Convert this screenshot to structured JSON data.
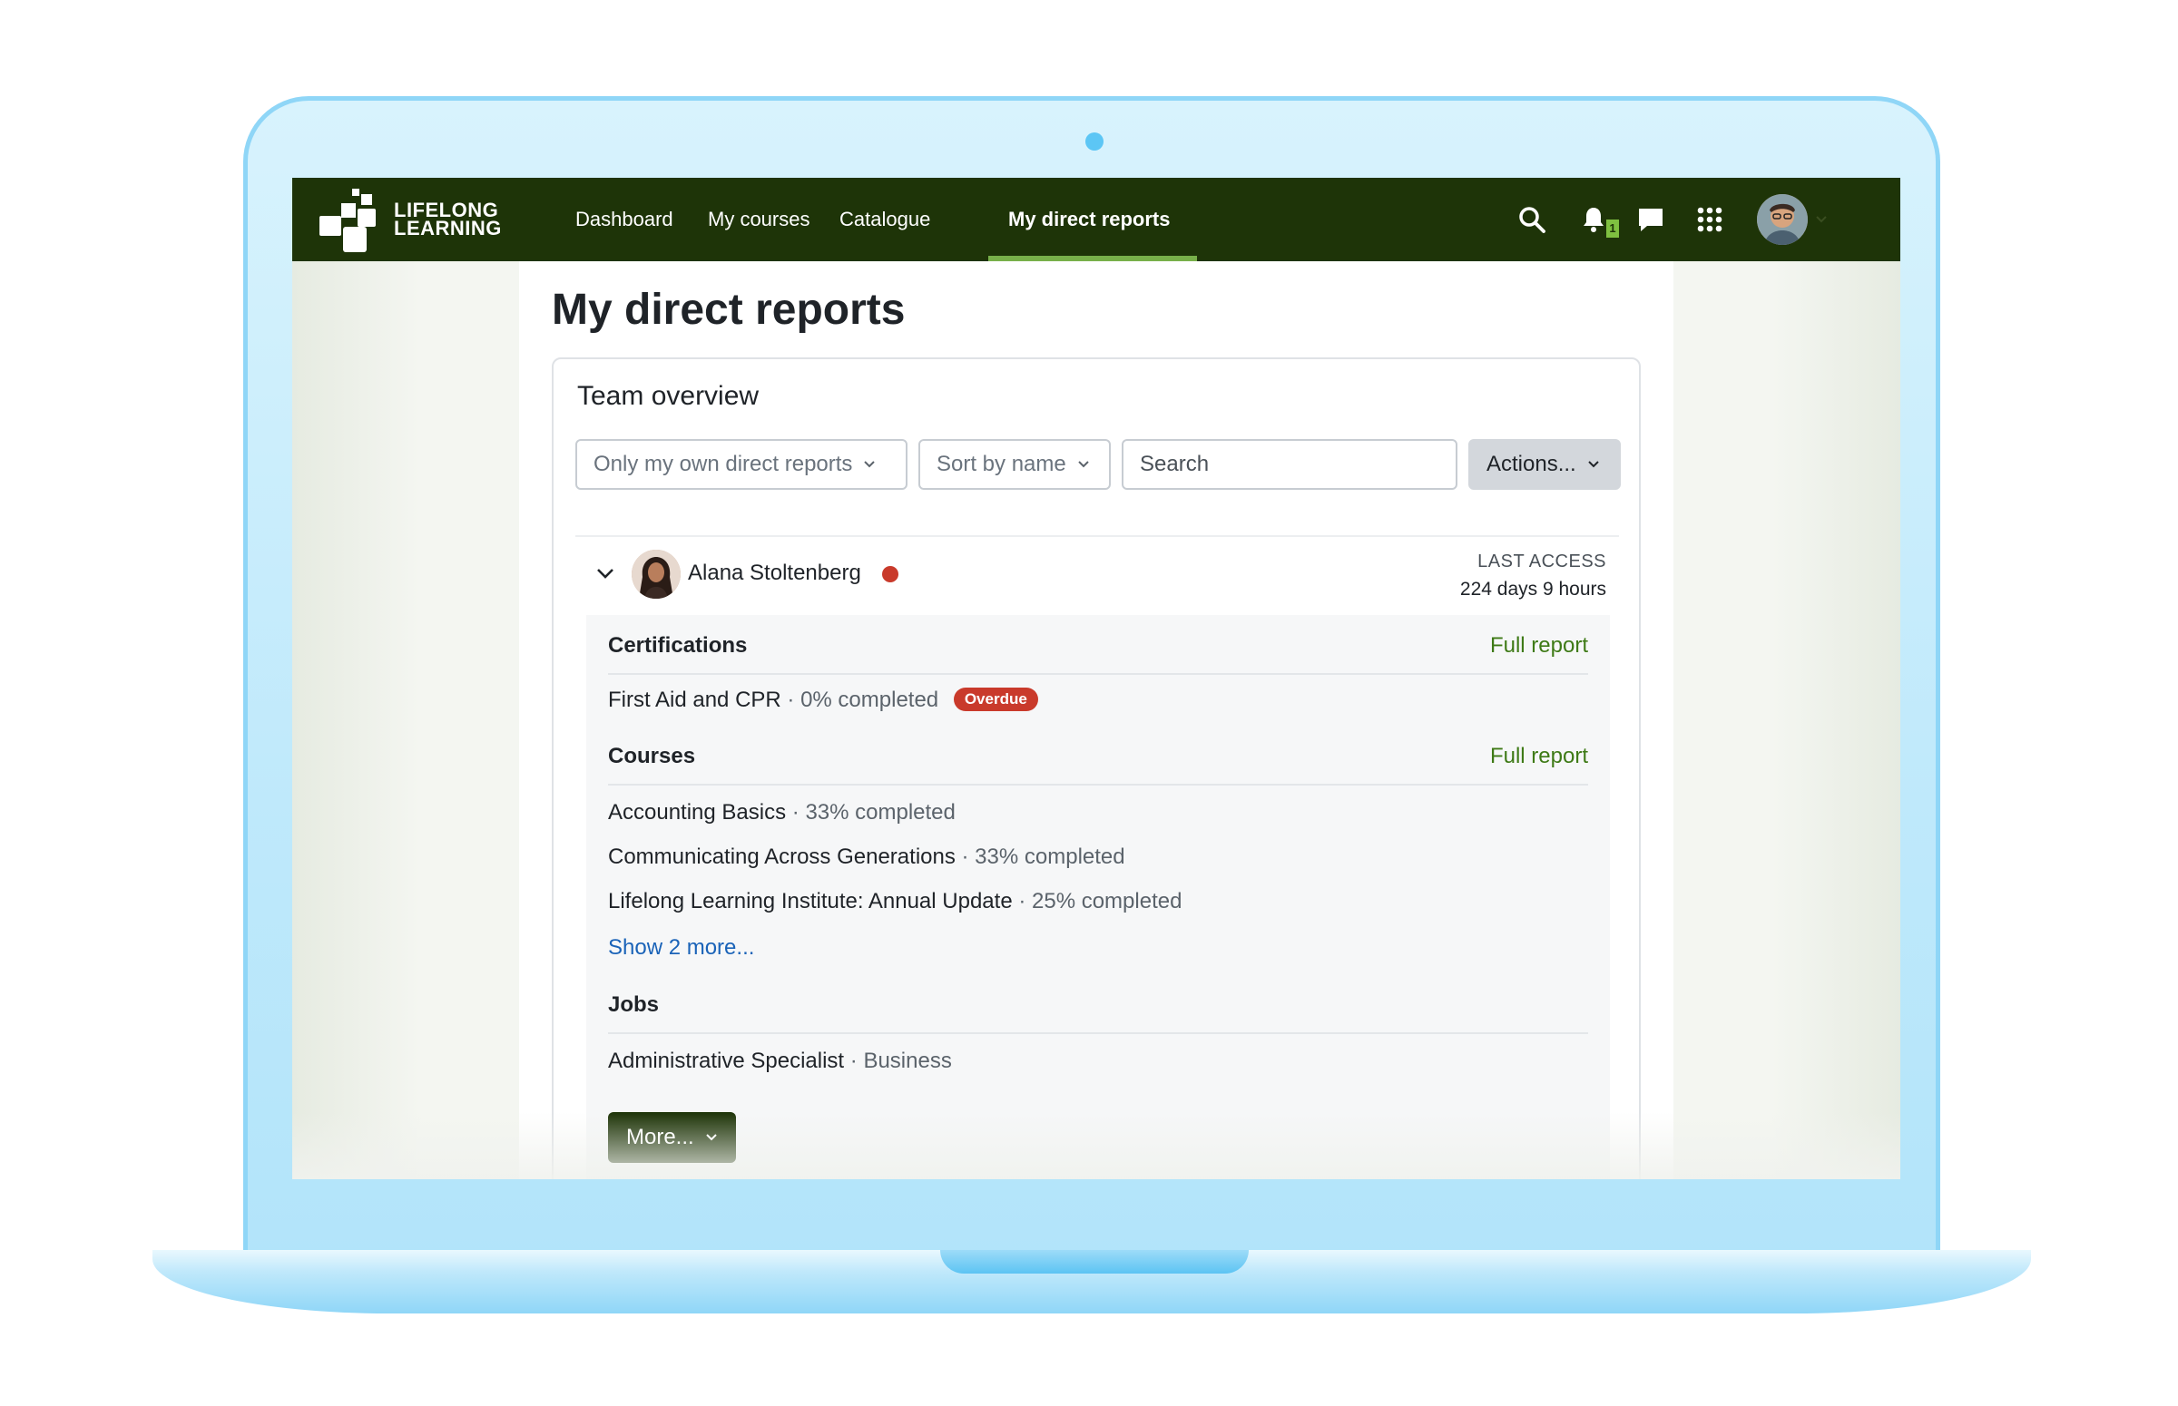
{
  "nav": {
    "brand_line1": "LIFELONG",
    "brand_line2": "LEARNING",
    "items": [
      {
        "label": "Dashboard"
      },
      {
        "label": "My courses"
      },
      {
        "label": "Catalogue"
      },
      {
        "label": "My direct reports",
        "active": true
      }
    ],
    "notification_count": "1",
    "icons": [
      "search-icon",
      "bell-icon",
      "chat-icon",
      "apps-grid-icon",
      "user-avatar"
    ]
  },
  "page": {
    "title": "My direct reports"
  },
  "card": {
    "title": "Team overview",
    "filter_label": "Only my own direct reports",
    "sort_label": "Sort by name",
    "search_placeholder": "Search",
    "actions_label": "Actions..."
  },
  "person": {
    "name": "Alana Stoltenberg",
    "status_color": "#c93a2b",
    "last_access_label": "LAST ACCESS",
    "last_access_value": "224 days 9 hours",
    "certifications": {
      "title": "Certifications",
      "full_report": "Full report",
      "items": [
        {
          "name": "First Aid and CPR",
          "progress": "· 0% completed",
          "badge": "Overdue"
        }
      ]
    },
    "courses": {
      "title": "Courses",
      "full_report": "Full report",
      "items": [
        {
          "name": "Accounting Basics",
          "progress": "· 33% completed"
        },
        {
          "name": "Communicating Across Generations",
          "progress": "· 33% completed"
        },
        {
          "name": "Lifelong Learning Institute: Annual Update",
          "progress": "· 25% completed"
        }
      ],
      "show_more": "Show 2 more..."
    },
    "jobs": {
      "title": "Jobs",
      "items": [
        {
          "name": "Administrative Specialist",
          "org": "· Business"
        }
      ]
    },
    "more_label": "More..."
  },
  "colors": {
    "nav_bg": "#1e3408",
    "nav_active_underline": "#78b04a",
    "link_green": "#3e7a16",
    "link_blue": "#1a63b8",
    "danger": "#c93a2b"
  }
}
